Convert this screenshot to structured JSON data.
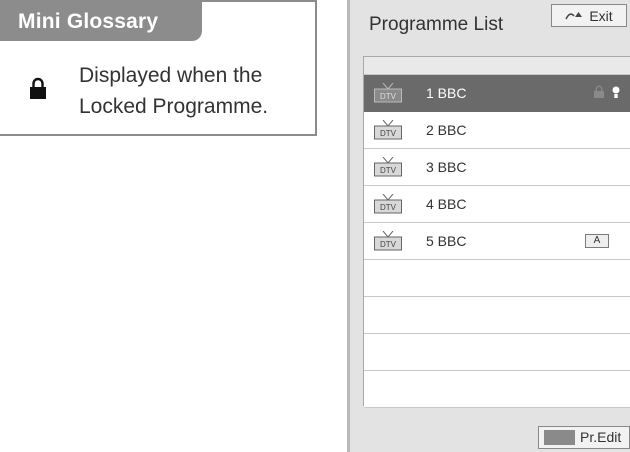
{
  "glossary": {
    "title": "Mini Glossary",
    "icon": "lock-icon",
    "line1": "Displayed when the",
    "line2": "Locked Programme."
  },
  "programme_list": {
    "title": "Programme List",
    "exit_label": "Exit",
    "tv_icon_label": "DTV",
    "programmes": [
      {
        "name": "1 BBC",
        "selected": true,
        "locked": true,
        "favourite": true
      },
      {
        "name": "2 BBC"
      },
      {
        "name": "3 BBC"
      },
      {
        "name": "4 BBC"
      },
      {
        "name": "5 BBC",
        "audio_badge": "A"
      }
    ],
    "edit_label": "Pr.Edit"
  },
  "colors": {
    "accent_gray": "#8c8c8c",
    "selected_row": "#6a6a6a",
    "panel_bg": "#e3e3e3"
  }
}
